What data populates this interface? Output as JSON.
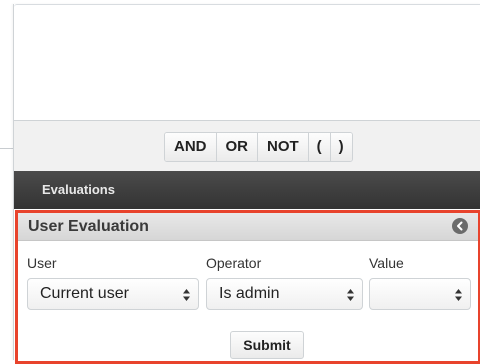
{
  "toolbar": {
    "operators": [
      "AND",
      "OR",
      "NOT",
      "(",
      ")"
    ]
  },
  "evaluations": {
    "title": "Evaluations"
  },
  "user_evaluation": {
    "title": "User Evaluation",
    "collapse_icon": "arrow-left-circle-icon",
    "fields": {
      "user": {
        "label": "User",
        "value": "Current user"
      },
      "operator": {
        "label": "Operator",
        "value": "Is admin"
      },
      "value": {
        "label": "Value",
        "value": ""
      }
    },
    "submit_label": "Submit"
  },
  "colors": {
    "highlight_border": "#e8432c",
    "header_dark": "#3d3d3d"
  }
}
